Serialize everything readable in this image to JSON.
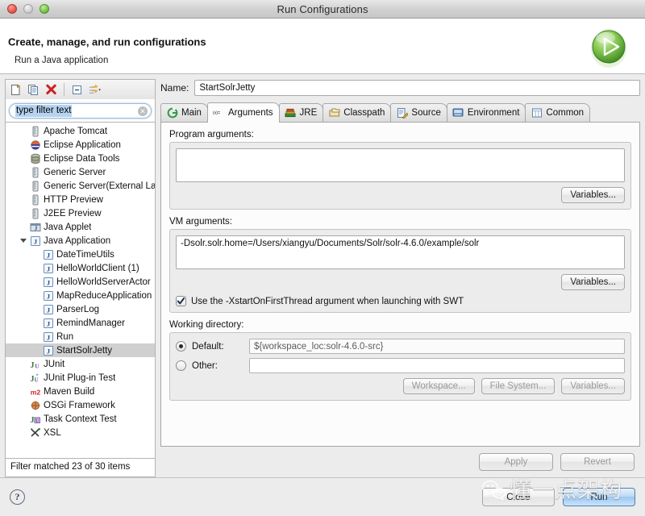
{
  "window": {
    "title": "Run Configurations",
    "traffic_lights": [
      "close-button",
      "minimize-button",
      "maximize-button"
    ]
  },
  "header": {
    "title": "Create, manage, and run configurations",
    "subtitle": "Run a Java application",
    "badge_icon": "run-green-play-icon"
  },
  "tree_toolbar": {
    "items": [
      {
        "name": "new-launch-configuration-button",
        "icon": "new-document-icon"
      },
      {
        "name": "duplicate-launch-configuration-button",
        "icon": "copy-icon"
      },
      {
        "name": "delete-launch-configuration-button",
        "icon": "red-x-delete-icon"
      },
      {
        "name": "collapse-all-button",
        "icon": "collapse-all-icon"
      },
      {
        "name": "filter-button",
        "icon": "filter-arrows-icon"
      }
    ]
  },
  "filter": {
    "value": "type filter text",
    "placeholder": "type filter text",
    "clear_icon": "clear-circle-icon"
  },
  "tree": {
    "items": [
      {
        "label": "Apache Tomcat",
        "icon": "server-icon",
        "indent": 1,
        "selected": false,
        "twisty": "none"
      },
      {
        "label": "Eclipse Application",
        "icon": "eclipse-icon",
        "indent": 1,
        "selected": false,
        "twisty": "none"
      },
      {
        "label": "Eclipse Data Tools",
        "icon": "database-icon",
        "indent": 1,
        "selected": false,
        "twisty": "none"
      },
      {
        "label": "Generic Server",
        "icon": "server-icon",
        "indent": 1,
        "selected": false,
        "twisty": "none"
      },
      {
        "label": "Generic Server(External La",
        "icon": "server-icon",
        "indent": 1,
        "selected": false,
        "twisty": "none"
      },
      {
        "label": "HTTP Preview",
        "icon": "server-icon",
        "indent": 1,
        "selected": false,
        "twisty": "none"
      },
      {
        "label": "J2EE Preview",
        "icon": "server-icon",
        "indent": 1,
        "selected": false,
        "twisty": "none"
      },
      {
        "label": "Java Applet",
        "icon": "java-applet-icon",
        "indent": 1,
        "selected": false,
        "twisty": "none"
      },
      {
        "label": "Java Application",
        "icon": "java-application-icon",
        "indent": 1,
        "selected": false,
        "twisty": "open"
      },
      {
        "label": "DateTimeUtils",
        "icon": "java-class-icon",
        "indent": 2,
        "selected": false,
        "twisty": "none"
      },
      {
        "label": "HelloWorldClient (1)",
        "icon": "java-class-icon",
        "indent": 2,
        "selected": false,
        "twisty": "none"
      },
      {
        "label": "HelloWorldServerActor",
        "icon": "java-class-icon",
        "indent": 2,
        "selected": false,
        "twisty": "none"
      },
      {
        "label": "MapReduceApplication",
        "icon": "java-class-icon",
        "indent": 2,
        "selected": false,
        "twisty": "none"
      },
      {
        "label": "ParserLog",
        "icon": "java-class-icon",
        "indent": 2,
        "selected": false,
        "twisty": "none"
      },
      {
        "label": "RemindManager",
        "icon": "java-class-icon",
        "indent": 2,
        "selected": false,
        "twisty": "none"
      },
      {
        "label": "Run",
        "icon": "java-class-icon",
        "indent": 2,
        "selected": false,
        "twisty": "none"
      },
      {
        "label": "StartSolrJetty",
        "icon": "java-class-icon",
        "indent": 2,
        "selected": true,
        "twisty": "none"
      },
      {
        "label": "JUnit",
        "icon": "junit-icon",
        "indent": 1,
        "selected": false,
        "twisty": "none"
      },
      {
        "label": "JUnit Plug-in Test",
        "icon": "junit-plugin-icon",
        "indent": 1,
        "selected": false,
        "twisty": "none"
      },
      {
        "label": "Maven Build",
        "icon": "maven-m2-icon",
        "indent": 1,
        "selected": false,
        "twisty": "none"
      },
      {
        "label": "OSGi Framework",
        "icon": "osgi-icon",
        "indent": 1,
        "selected": false,
        "twisty": "none"
      },
      {
        "label": "Task Context Test",
        "icon": "task-context-junit-icon",
        "indent": 1,
        "selected": false,
        "twisty": "none"
      },
      {
        "label": "XSL",
        "icon": "xsl-icon",
        "indent": 1,
        "selected": false,
        "twisty": "none"
      }
    ],
    "status": "Filter matched 23 of 30 items"
  },
  "name_field": {
    "label": "Name:",
    "value": "StartSolrJetty"
  },
  "tabs": [
    {
      "label": "Main",
      "icon": "main-green-icon",
      "active": false
    },
    {
      "label": "Arguments",
      "icon": "arguments-xy-icon",
      "active": true
    },
    {
      "label": "JRE",
      "icon": "jre-books-icon",
      "active": false
    },
    {
      "label": "Classpath",
      "icon": "classpath-folders-icon",
      "active": false
    },
    {
      "label": "Source",
      "icon": "source-pencil-icon",
      "active": false
    },
    {
      "label": "Environment",
      "icon": "environment-icon",
      "active": false
    },
    {
      "label": "Common",
      "icon": "common-table-icon",
      "active": false
    }
  ],
  "program_arguments": {
    "label": "Program arguments:",
    "value": "",
    "variables_button": "Variables..."
  },
  "vm_arguments": {
    "label": "VM arguments:",
    "value": "-Dsolr.solr.home=/Users/xiangyu/Documents/Solr/solr-4.6.0/example/solr",
    "variables_button": "Variables...",
    "checkbox_label": "Use the -XstartOnFirstThread argument when launching with SWT",
    "checkbox_checked": true
  },
  "working_directory": {
    "label": "Working directory:",
    "default_label": "Default:",
    "default_value": "${workspace_loc:solr-4.6.0-src}",
    "default_selected": true,
    "other_label": "Other:",
    "other_value": "",
    "other_selected": false,
    "buttons": [
      "Workspace...",
      "File System...",
      "Variables..."
    ]
  },
  "footer_actions": {
    "apply": "Apply",
    "revert": "Revert",
    "close": "Close",
    "run": "Run",
    "help_icon": "question-mark-help-icon"
  },
  "watermark": {
    "text": "懂一点架构",
    "logo_icon": "wechat-logo-icon"
  },
  "colors": {
    "accent_blue": "#9cc6ee",
    "selection_gray": "#d0d0d0",
    "filter_selection": "#b5d3f0",
    "window_bg": "#ececec",
    "panel_bg": "#fcfcfc",
    "group_bg": "#ececec",
    "close_red": "#ec6a5e",
    "maximize_green": "#8ed15c",
    "delete_red": "#cc2222"
  }
}
